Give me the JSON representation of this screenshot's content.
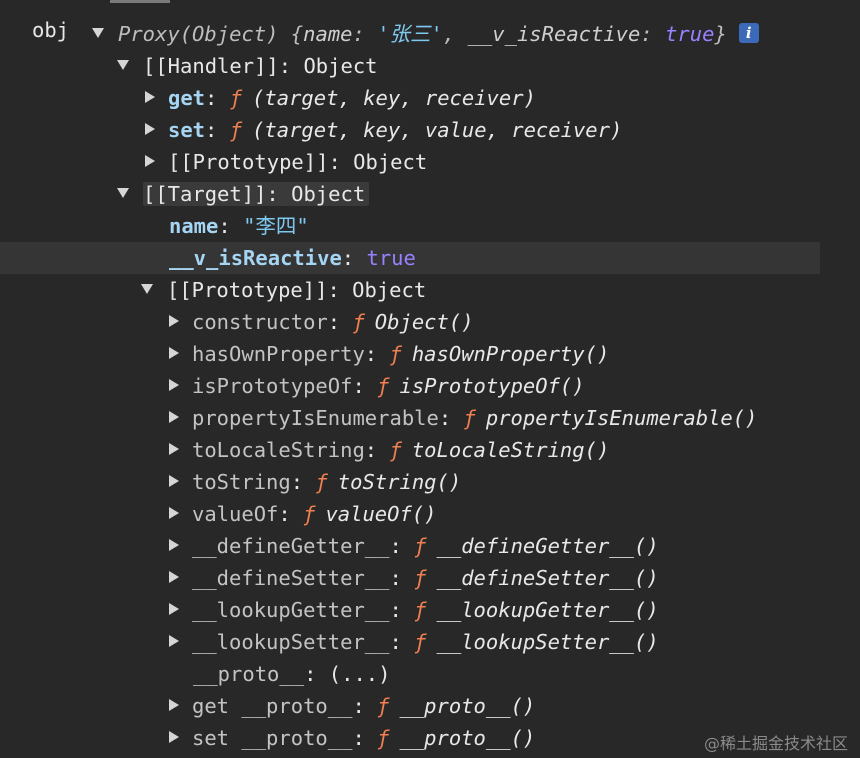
{
  "console": {
    "variable_name": "obj",
    "proxy_preview": {
      "prefix": "Proxy(Object) {",
      "key1": "name",
      "value1": "'张三'",
      "sep": ", ",
      "key2": "__v_isReactive",
      "value2": "true",
      "suffix": "}"
    },
    "info_badge": "i",
    "handler": {
      "label": "[[Handler]]",
      "type": "Object",
      "children": [
        {
          "key": "get",
          "sig": "(target, key, receiver)"
        },
        {
          "key": "set",
          "sig": "(target, key, value, receiver)"
        }
      ],
      "prototype": {
        "label": "[[Prototype]]",
        "type": "Object"
      }
    },
    "target": {
      "label": "[[Target]]",
      "type": "Object",
      "name_key": "name",
      "name_value": "\"李四\"",
      "reactive_key": "__v_isReactive",
      "reactive_value": "true",
      "prototype": {
        "label": "[[Prototype]]",
        "type": "Object",
        "methods": [
          {
            "key": "constructor",
            "fn": "Object()"
          },
          {
            "key": "hasOwnProperty",
            "fn": "hasOwnProperty()"
          },
          {
            "key": "isPrototypeOf",
            "fn": "isPrototypeOf()"
          },
          {
            "key": "propertyIsEnumerable",
            "fn": "propertyIsEnumerable()"
          },
          {
            "key": "toLocaleString",
            "fn": "toLocaleString()"
          },
          {
            "key": "toString",
            "fn": "toString()"
          },
          {
            "key": "valueOf",
            "fn": "valueOf()"
          },
          {
            "key": "__defineGetter__",
            "fn": "__defineGetter__()"
          },
          {
            "key": "__defineSetter__",
            "fn": "__defineSetter__()"
          },
          {
            "key": "__lookupGetter__",
            "fn": "__lookupGetter__()"
          },
          {
            "key": "__lookupSetter__",
            "fn": "__lookupSetter__()"
          }
        ],
        "proto_key": "__proto__",
        "proto_value": "(...)",
        "accessors": [
          {
            "key": "get __proto__",
            "fn": "__proto__()"
          },
          {
            "key": "set __proto__",
            "fn": "__proto__()"
          }
        ]
      }
    },
    "function_symbol": "ƒ",
    "colon": ":"
  },
  "watermark": "@稀土掘金技术社区"
}
